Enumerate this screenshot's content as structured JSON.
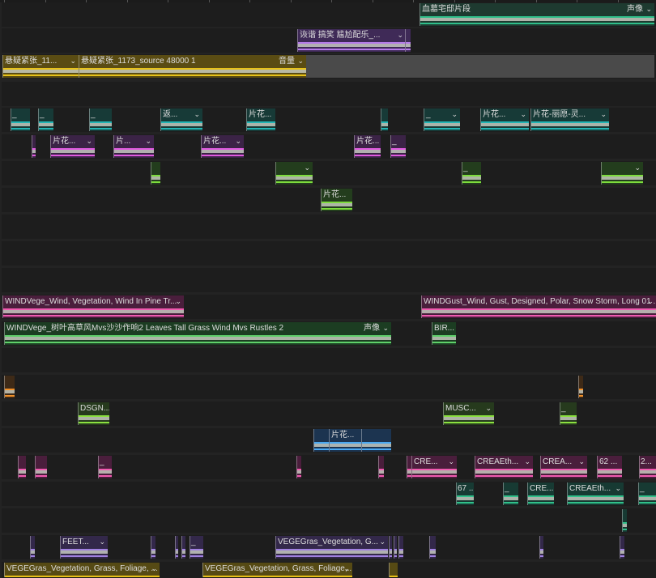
{
  "tracks": [
    {
      "color": "#1e3a30",
      "line": "#2fbf8a",
      "clips": [
        {
          "label": "血墓宅邸片段",
          "menu": "声像"
        }
      ]
    },
    {
      "color": "#3f2a57",
      "line": "#b57be8",
      "clips": [
        {
          "label": "诙谐 搞笑 尴尬配乐_...",
          "chev": true
        },
        {
          "label": ""
        }
      ]
    },
    {
      "color": "#5a4c13",
      "line": "#e7c21a",
      "clips": [
        {
          "label": "悬疑紧张_11...",
          "chev": true
        },
        {
          "label": "悬疑紧张_1173_source 48000 1",
          "menu": "音量"
        }
      ]
    },
    {
      "color": "#1d1d1d",
      "line": "#000",
      "clips": []
    },
    {
      "color": "#173a37",
      "line": "#22b5b5",
      "clips": [
        {
          "label": "_"
        },
        {
          "label": "_"
        },
        {
          "label": "_"
        },
        {
          "label": "返...",
          "chev": true
        },
        {
          "label": "片花..."
        },
        {
          "label": ""
        },
        {
          "label": "_",
          "chev": true
        },
        {
          "label": "片花...",
          "chev": true
        },
        {
          "label": "片花-丽愿-灵...",
          "chev": true
        }
      ]
    },
    {
      "color": "#3b2346",
      "line": "#e05ae0",
      "clips": [
        {
          "label": ""
        },
        {
          "label": "片花...",
          "chev": true
        },
        {
          "label": "片...",
          "chev": true
        },
        {
          "label": "片花...",
          "chev": true
        },
        {
          "label": "片花..."
        },
        {
          "label": "_"
        }
      ]
    },
    {
      "color": "#233d1d",
      "line": "#7ddc3c",
      "clips": [
        {
          "label": ""
        },
        {
          "label": "",
          "chev": true
        },
        {
          "label": "_"
        },
        {
          "label": "",
          "chev": true
        }
      ]
    },
    {
      "color": "#233d1d",
      "line": "#7ddc3c",
      "clips": [
        {
          "label": "片花..."
        }
      ]
    },
    {
      "color": "#1d1d1d",
      "line": "#000",
      "clips": []
    },
    {
      "color": "#1d1d1d",
      "line": "#000",
      "clips": []
    },
    {
      "color": "#1d1d1d",
      "line": "#000",
      "clips": []
    },
    {
      "color": "#4a1e3c",
      "line": "#f05ab0",
      "clips": [
        {
          "label": "WINDVege_Wind, Vegetation, Wind In Pine Tr...",
          "chev": true
        },
        {
          "label": "WINDGust_Wind, Gust, Designed, Polar, Snow Storm, Long 01 ...",
          "chev": true
        }
      ]
    },
    {
      "color": "#1c3d22",
      "line": "#5fd06a",
      "clips": [
        {
          "label": "WINDVege_树叶高草风Mvs沙沙作响2 Leaves Tall Grass Wind Mvs Rustles 2",
          "menu": "声像"
        },
        {
          "label": "BIR..."
        }
      ]
    },
    {
      "color": "#1d1d1d",
      "line": "#000",
      "clips": []
    },
    {
      "color": "#3e2a17",
      "line": "#f0902a",
      "clips": [
        {
          "label": ""
        },
        {
          "label": ""
        }
      ]
    },
    {
      "color": "#263a1d",
      "line": "#8be040",
      "clips": [
        {
          "label": "DSGN..."
        },
        {
          "label": "MUSC...",
          "chev": true
        },
        {
          "label": "_"
        }
      ]
    },
    {
      "color": "#1c3450",
      "line": "#4aa8f0",
      "clips": [
        {
          "label": ""
        },
        {
          "label": "片花..."
        },
        {
          "label": ""
        }
      ]
    },
    {
      "color": "#4a1e3c",
      "line": "#f05ab0",
      "clips": [
        {
          "label": ""
        },
        {
          "label": ""
        },
        {
          "label": "_"
        },
        {
          "label": ""
        },
        {
          "label": ""
        },
        {
          "label": ""
        },
        {
          "label": "CRE...",
          "chev": true
        },
        {
          "label": "CREAEth...",
          "chev": true
        },
        {
          "label": "CREA...",
          "chev": true
        },
        {
          "label": "62 ..."
        },
        {
          "label": "2..."
        }
      ]
    },
    {
      "color": "#173a33",
      "line": "#30c08a",
      "clips": [
        {
          "label": "67 ..."
        },
        {
          "label": "_"
        },
        {
          "label": "CRE..."
        },
        {
          "label": "CREAEth...",
          "chev": true
        },
        {
          "label": "_"
        }
      ]
    },
    {
      "color": "#173a33",
      "line": "#30c08a",
      "clips": [
        {
          "label": ""
        }
      ]
    },
    {
      "color": "#33284a",
      "line": "#a080e0",
      "clips": [
        {
          "label": ""
        },
        {
          "label": "FEET...",
          "chev": true
        },
        {
          "label": ""
        },
        {
          "label": ""
        },
        {
          "label": ""
        },
        {
          "label": "_"
        },
        {
          "label": "VEGEGras_Vegetation, G...",
          "chev": true
        },
        {
          "label": ""
        },
        {
          "label": ""
        },
        {
          "label": ""
        },
        {
          "label": ""
        },
        {
          "label": ""
        },
        {
          "label": ""
        }
      ]
    },
    {
      "color": "#564a14",
      "line": "#e8c018",
      "clips": [
        {
          "label": "VEGEGras_Vegetation, Grass, Foliage, ...",
          "chev": true
        },
        {
          "label": "VEGEGras_Vegetation, Grass, Foliage,...",
          "chev": true
        },
        {
          "label": ""
        }
      ]
    }
  ]
}
